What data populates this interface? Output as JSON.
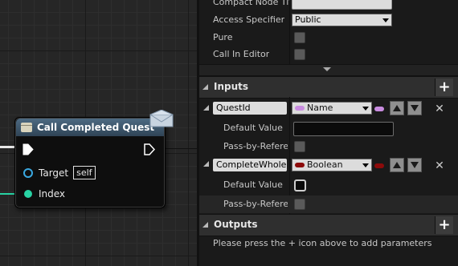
{
  "node": {
    "title": "Call Completed Quest",
    "pins": [
      {
        "label": "Target",
        "default": "self"
      },
      {
        "label": "Index"
      }
    ],
    "colors": {
      "header": "#4d6a82",
      "exec": "#ffffff",
      "target_pin": "#3aa8e0",
      "index_pin": "#28d3a4"
    }
  },
  "details": {
    "compact_node_title": {
      "label": "Compact Node Tit",
      "value": ""
    },
    "access_specifier": {
      "label": "Access Specifier",
      "value": "Public"
    },
    "pure": {
      "label": "Pure",
      "checked": false
    },
    "call_in_editor": {
      "label": "Call In Editor",
      "checked": false
    },
    "inputs": {
      "title": "Inputs",
      "add_icon": "plus-icon",
      "params": [
        {
          "name": "QuestId",
          "type": "Name",
          "type_color": "#c98ce0",
          "default_label": "Default Value",
          "default_value": "",
          "pass_label": "Pass-by-Refere",
          "pass_checked": false
        },
        {
          "name": "CompleteWholeQ",
          "type": "Boolean",
          "type_color": "#8c0b0b",
          "default_label": "Default Value",
          "default_checked": false,
          "pass_label": "Pass-by-Refere",
          "pass_checked": false
        }
      ]
    },
    "outputs": {
      "title": "Outputs",
      "add_icon": "plus-icon",
      "hint": "Please press the + icon above to add parameters"
    }
  }
}
